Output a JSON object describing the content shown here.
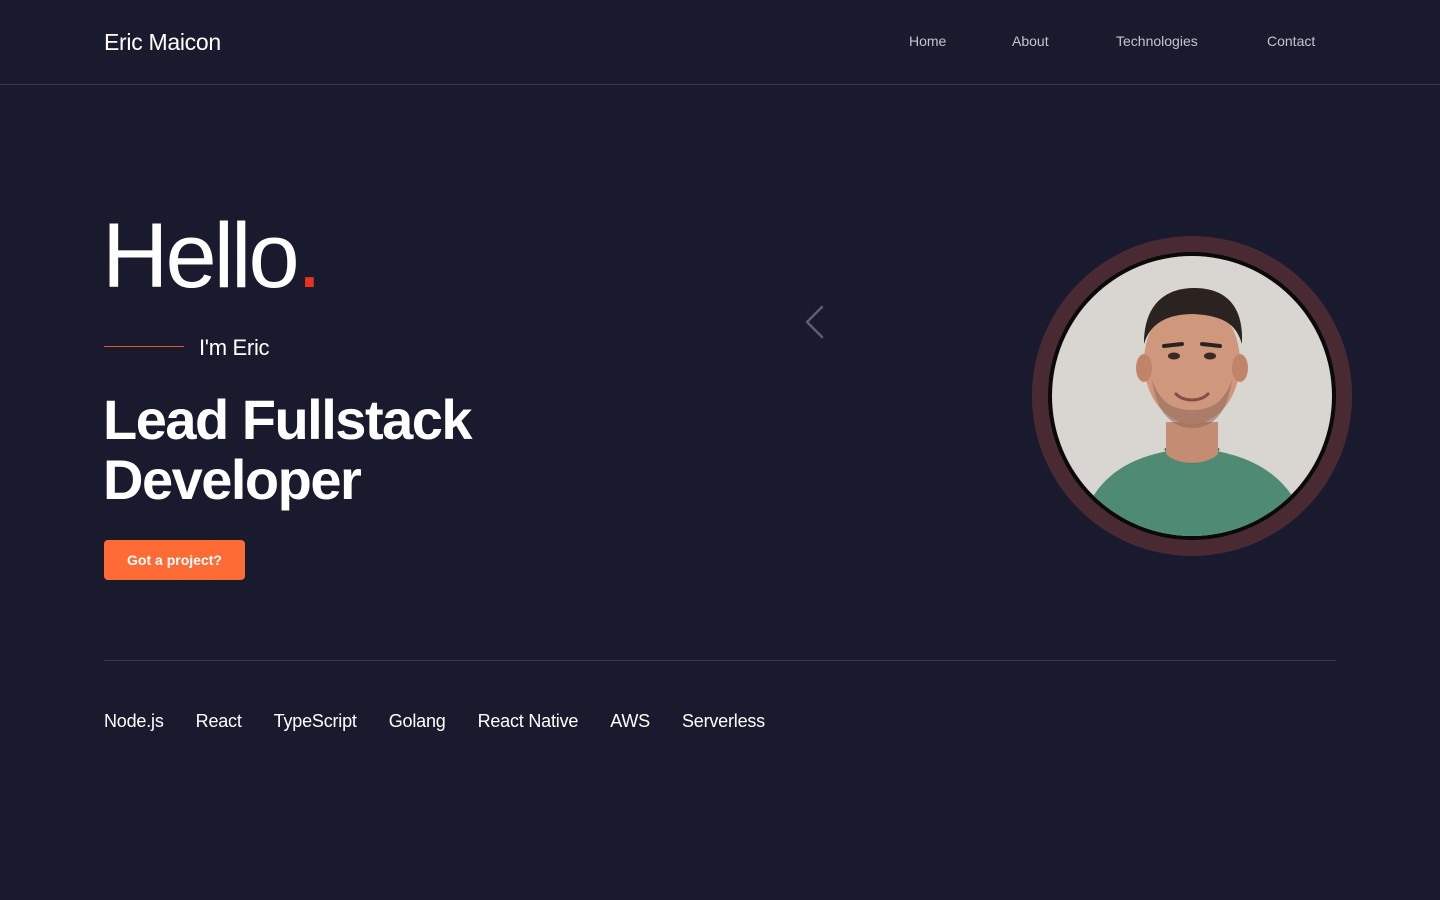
{
  "header": {
    "brand": "Eric Maicon",
    "nav": {
      "home": "Home",
      "about": "About",
      "technologies": "Technologies",
      "contact": "Contact"
    }
  },
  "hero": {
    "greeting": "Hello",
    "greeting_dot": ".",
    "intro": "I'm Eric",
    "role_line1": "Lead Fullstack",
    "role_line2": "Developer",
    "cta_label": "Got a project?",
    "carousel_icon": "chevron-left-icon",
    "accent_color": "#ff6b35"
  },
  "technologies": [
    "Node.js",
    "React",
    "TypeScript",
    "Golang",
    "React Native",
    "AWS",
    "Serverless"
  ]
}
